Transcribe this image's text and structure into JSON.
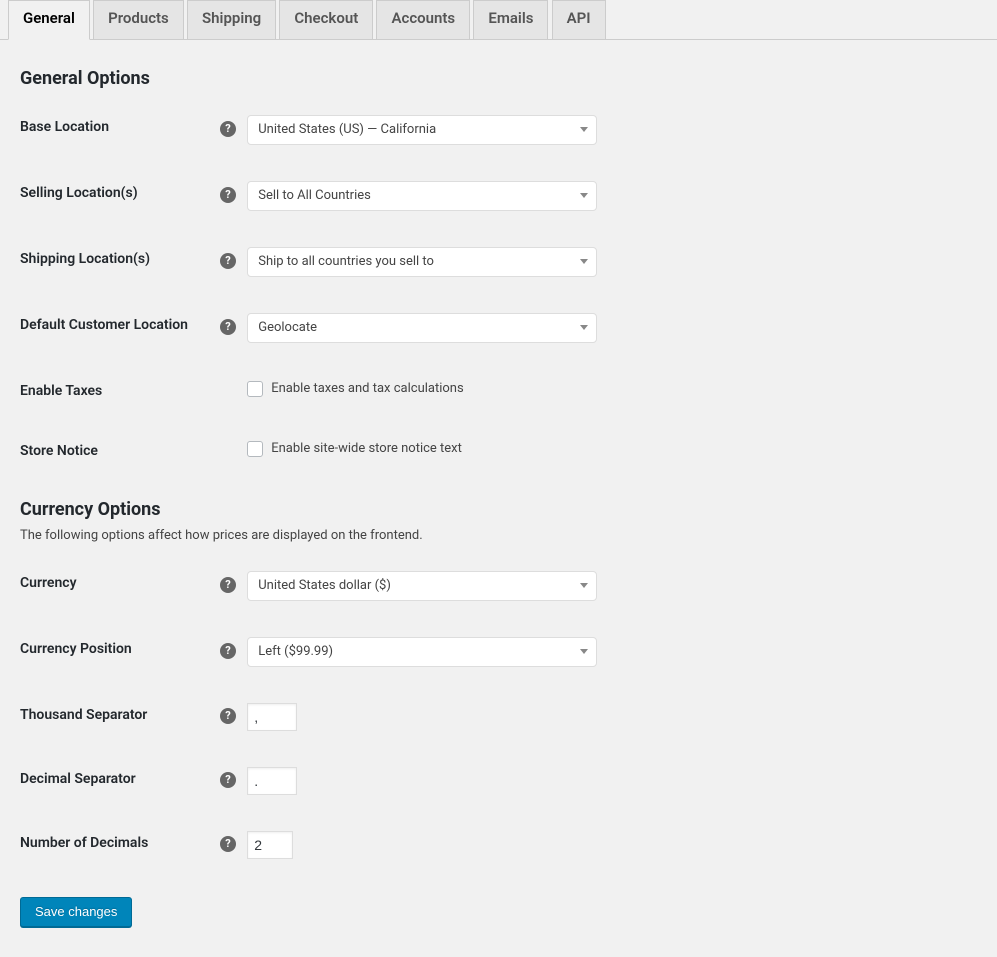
{
  "tabs": [
    {
      "label": "General",
      "active": true
    },
    {
      "label": "Products",
      "active": false
    },
    {
      "label": "Shipping",
      "active": false
    },
    {
      "label": "Checkout",
      "active": false
    },
    {
      "label": "Accounts",
      "active": false
    },
    {
      "label": "Emails",
      "active": false
    },
    {
      "label": "API",
      "active": false
    }
  ],
  "general": {
    "heading": "General Options",
    "base_location": {
      "label": "Base Location",
      "value": "United States (US) — California"
    },
    "selling_locations": {
      "label": "Selling Location(s)",
      "value": "Sell to All Countries"
    },
    "shipping_locations": {
      "label": "Shipping Location(s)",
      "value": "Ship to all countries you sell to"
    },
    "default_customer_location": {
      "label": "Default Customer Location",
      "value": "Geolocate"
    },
    "enable_taxes": {
      "label": "Enable Taxes",
      "checkbox_label": "Enable taxes and tax calculations",
      "checked": false
    },
    "store_notice": {
      "label": "Store Notice",
      "checkbox_label": "Enable site-wide store notice text",
      "checked": false
    }
  },
  "currency": {
    "heading": "Currency Options",
    "description": "The following options affect how prices are displayed on the frontend.",
    "currency": {
      "label": "Currency",
      "value": "United States dollar ($)"
    },
    "position": {
      "label": "Currency Position",
      "value": "Left ($99.99)"
    },
    "thousand_sep": {
      "label": "Thousand Separator",
      "value": ","
    },
    "decimal_sep": {
      "label": "Decimal Separator",
      "value": "."
    },
    "num_decimals": {
      "label": "Number of Decimals",
      "value": "2"
    }
  },
  "save_label": "Save changes"
}
